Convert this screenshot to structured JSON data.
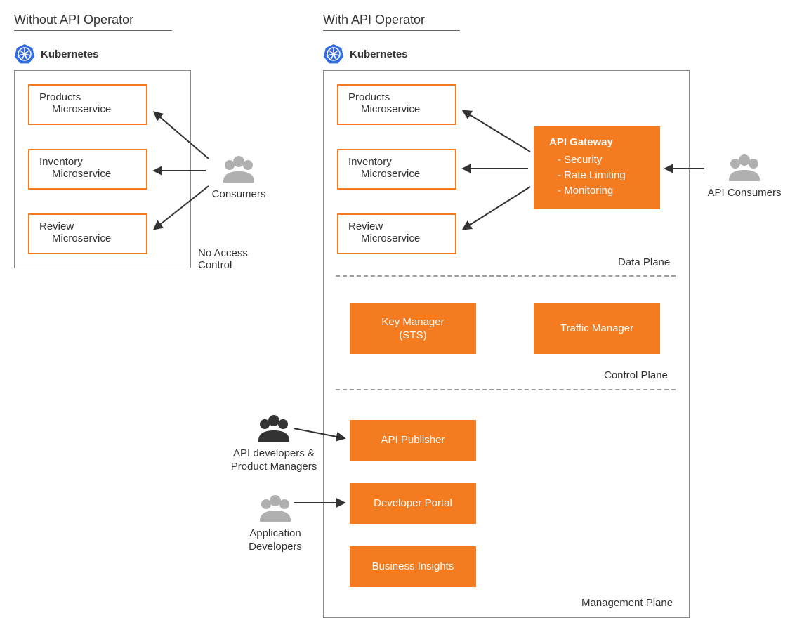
{
  "left": {
    "title": "Without API Operator",
    "k8s": "Kubernetes",
    "microservices": [
      {
        "name": "Products",
        "sub": "Microservice"
      },
      {
        "name": "Inventory",
        "sub": "Microservice"
      },
      {
        "name": "Review",
        "sub": "Microservice"
      }
    ],
    "consumers": "Consumers",
    "note": "No Access\nControl"
  },
  "right": {
    "title": "With API Operator",
    "k8s": "Kubernetes",
    "microservices": [
      {
        "name": "Products",
        "sub": "Microservice"
      },
      {
        "name": "Inventory",
        "sub": "Microservice"
      },
      {
        "name": "Review",
        "sub": "Microservice"
      }
    ],
    "gateway": {
      "title": "API Gateway",
      "items": [
        "- Security",
        "- Rate Limiting",
        "- Monitoring"
      ]
    },
    "api_consumers": "API Consumers",
    "data_plane": "Data Plane",
    "control_plane": "Control Plane",
    "key_manager": "Key Manager\n(STS)",
    "traffic_manager": "Traffic Manager",
    "management_plane": "Management Plane",
    "api_publisher": "API Publisher",
    "developer_portal": "Developer Portal",
    "business_insights": "Business Insights",
    "actor_devpm": "API developers &\nProduct Managers",
    "actor_appdev": "Application\nDevelopers"
  },
  "colors": {
    "accent": "#F47B20",
    "k8s_blue": "#326CE5"
  }
}
